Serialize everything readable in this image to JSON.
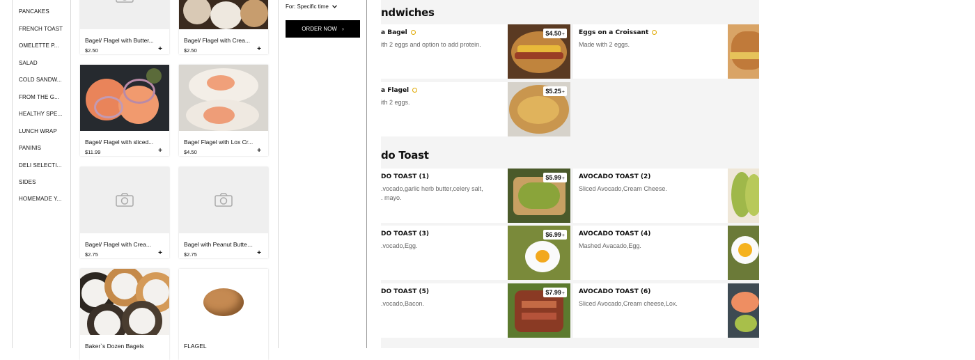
{
  "sidebar": {
    "categories": [
      "PANCAKES",
      "FRENCH TOAST",
      "OMELETTE P...",
      "SALAD",
      "COLD SANDW...",
      "FROM THE G...",
      "HEALTHY SPE...",
      "LUNCH WRAP",
      "PANINIS",
      "DELI SELECTI...",
      "SIDES",
      "HOMEMADE Y..."
    ]
  },
  "products": [
    {
      "name": "Bagel/ Flagel with Butter...",
      "price": "$2.50",
      "add": "+"
    },
    {
      "name": "Bagel/ Flagel with Crea...",
      "price": "$2.50",
      "add": "+"
    },
    {
      "name": "Bagel/ Flagel with sliced...",
      "price": "$11.99",
      "add": "+"
    },
    {
      "name": "Bage/ Flagel with Lox Cr...",
      "price": "$4.50",
      "add": "+"
    },
    {
      "name": "Bagel/ Flagel with Crea...",
      "price": "$2.75",
      "add": "+"
    },
    {
      "name": "Bagel with Peanut Butter...",
      "price": "$2.75",
      "add": "+"
    },
    {
      "name": "Baker`s Dozen Bagels",
      "price": "",
      "add": ""
    },
    {
      "name": "FLAGEL",
      "price": "",
      "add": ""
    }
  ],
  "order": {
    "for_time": "For: Specific time",
    "order_now": "ORDER NOW",
    "order_chevron": "›"
  },
  "menu": {
    "sections": [
      {
        "title": "ndwiches"
      },
      {
        "title": "do Toast"
      }
    ],
    "items": [
      {
        "title": "a Bagel",
        "desc": "ith 2 eggs and option to add protein.",
        "price": "$4.50",
        "plus": "+"
      },
      {
        "title": "Eggs on a Croissant",
        "desc": "Made with 2 eggs.",
        "price": "",
        "plus": ""
      },
      {
        "title": "a Flagel",
        "desc": "ith 2 eggs.",
        "price": "$5.25",
        "plus": "+"
      },
      {
        "title": "DO TOAST (1)",
        "desc": ".vocado,garlic herb butter,celery salt,",
        "desc2": ". mayo.",
        "price": "$5.99",
        "plus": "+"
      },
      {
        "title": "AVOCADO TOAST (2)",
        "desc": "Sliced Avocado,Cream Cheese.",
        "price": "",
        "plus": ""
      },
      {
        "title": "DO TOAST (3)",
        "desc": ".vocado,Egg.",
        "price": "$6.99",
        "plus": "+"
      },
      {
        "title": "AVOCADO TOAST (4)",
        "desc": "Mashed Avacado,Egg.",
        "price": "",
        "plus": ""
      },
      {
        "title": "DO TOAST (5)",
        "desc": ".vocado,Bacon.",
        "price": "$7.99",
        "plus": "+"
      },
      {
        "title": "AVOCADO TOAST (6)",
        "desc": "Sliced Avocado,Cream cheese,Lox.",
        "price": "",
        "plus": ""
      }
    ]
  },
  "icons": {
    "camera": "camera-icon",
    "badge": "award-badge-icon",
    "chevron": "chevron-down-icon"
  },
  "colors": {
    "badge": "#e0a800",
    "order_button": "#000000",
    "menu_bg": "#f4f4f4"
  }
}
